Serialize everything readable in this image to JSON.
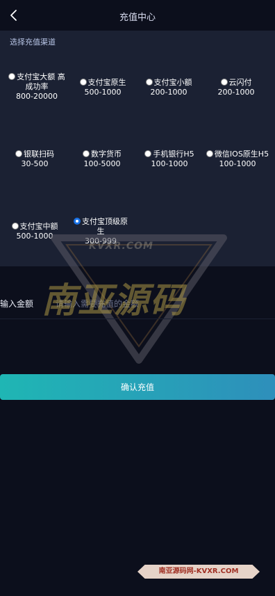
{
  "header": {
    "title": "充值中心"
  },
  "panel": {
    "section_label": "选择充值渠道",
    "channels": [
      {
        "label": "支付宝大额 高成功率",
        "range": "800-20000",
        "selected": false
      },
      {
        "label": "支付宝原生",
        "range": "500-1000",
        "selected": false
      },
      {
        "label": "支付宝小额",
        "range": "200-1000",
        "selected": false
      },
      {
        "label": "云闪付",
        "range": "200-1000",
        "selected": false
      },
      {
        "label": "银联扫码",
        "range": "30-500",
        "selected": false
      },
      {
        "label": "数字货币",
        "range": "100-5000",
        "selected": false
      },
      {
        "label": "手机银行H5",
        "range": "100-1000",
        "selected": false
      },
      {
        "label": "微信IOS原生H5",
        "range": "100-1000",
        "selected": false
      },
      {
        "label": "支付宝中额",
        "range": "500-1000",
        "selected": false
      },
      {
        "label": "支付宝顶级原生",
        "range": "300-999",
        "selected": true
      }
    ]
  },
  "amount": {
    "label": "输入金额",
    "placeholder": "请输入需要充值的金额",
    "value": ""
  },
  "confirm": {
    "label": "确认充值"
  },
  "watermark": {
    "big": "南亚源码",
    "small": "KVXR.COM",
    "badge": "南亚源码网-KVXR.COM"
  },
  "colors": {
    "accent_start": "#1fb6b4",
    "accent_end": "#2e8fbb",
    "radio_selected": "#1a73e8"
  }
}
